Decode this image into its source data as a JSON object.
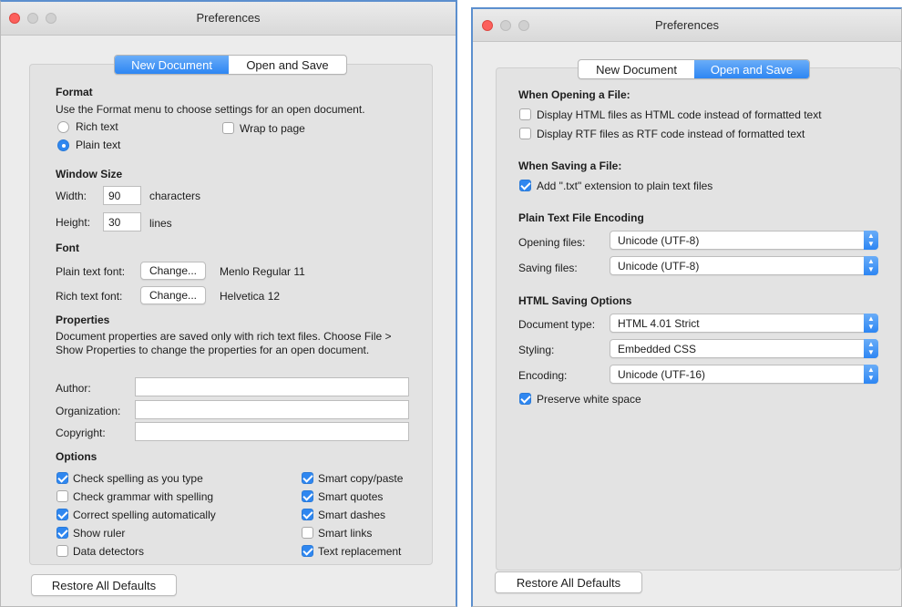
{
  "left": {
    "title": "Preferences",
    "tabs": {
      "new_document": "New Document",
      "open_and_save": "Open and Save",
      "active": "new_document"
    },
    "format": {
      "header": "Format",
      "description": "Use the Format menu to choose settings for an open document.",
      "rich_text": "Rich text",
      "plain_text": "Plain text",
      "selected": "plain_text",
      "wrap_to_page": "Wrap to page",
      "wrap_checked": false
    },
    "window_size": {
      "header": "Window Size",
      "width_label": "Width:",
      "width_value": "90",
      "width_unit": "characters",
      "height_label": "Height:",
      "height_value": "30",
      "height_unit": "lines"
    },
    "font": {
      "header": "Font",
      "plain_label": "Plain text font:",
      "plain_button": "Change...",
      "plain_value": "Menlo Regular 11",
      "rich_label": "Rich text font:",
      "rich_button": "Change...",
      "rich_value": "Helvetica 12"
    },
    "properties": {
      "header": "Properties",
      "description": "Document properties are saved only with rich text files. Choose File > Show Properties to change the properties for an open document.",
      "author_label": "Author:",
      "author_value": "",
      "organization_label": "Organization:",
      "organization_value": "",
      "copyright_label": "Copyright:",
      "copyright_value": ""
    },
    "options": {
      "header": "Options",
      "items": [
        {
          "label": "Check spelling as you type",
          "checked": true
        },
        {
          "label": "Check grammar with spelling",
          "checked": false
        },
        {
          "label": "Correct spelling automatically",
          "checked": true
        },
        {
          "label": "Show ruler",
          "checked": true
        },
        {
          "label": "Data detectors",
          "checked": false
        },
        {
          "label": "Smart copy/paste",
          "checked": true
        },
        {
          "label": "Smart quotes",
          "checked": true
        },
        {
          "label": "Smart dashes",
          "checked": true
        },
        {
          "label": "Smart links",
          "checked": false
        },
        {
          "label": "Text replacement",
          "checked": true
        }
      ]
    },
    "restore_button": "Restore All Defaults"
  },
  "right": {
    "title": "Preferences",
    "tabs": {
      "new_document": "New Document",
      "open_and_save": "Open and Save",
      "active": "open_and_save"
    },
    "opening": {
      "header": "When Opening a File:",
      "items": [
        {
          "label": "Display HTML files as HTML code instead of formatted text",
          "checked": false
        },
        {
          "label": "Display RTF files as RTF code instead of formatted text",
          "checked": false
        }
      ]
    },
    "saving": {
      "header": "When Saving a File:",
      "items": [
        {
          "label": "Add \".txt\" extension to plain text files",
          "checked": true
        }
      ]
    },
    "encoding": {
      "header": "Plain Text File Encoding",
      "opening_label": "Opening files:",
      "opening_value": "Unicode (UTF-8)",
      "saving_label": "Saving files:",
      "saving_value": "Unicode (UTF-8)"
    },
    "html": {
      "header": "HTML Saving Options",
      "doctype_label": "Document type:",
      "doctype_value": "HTML 4.01 Strict",
      "styling_label": "Styling:",
      "styling_value": "Embedded CSS",
      "encoding_label": "Encoding:",
      "encoding_value": "Unicode (UTF-16)",
      "preserve_label": "Preserve white space",
      "preserve_checked": true
    },
    "restore_button": "Restore All Defaults"
  },
  "colors": {
    "accent": "#2f87f0",
    "close": "#fc605c",
    "window_bg": "#ececec",
    "panel_bg": "#e3e3e3",
    "frame": "#5c8fce"
  },
  "icons": {
    "traffic_close": "close-dot",
    "traffic_minimize": "minimize-dot",
    "traffic_zoom": "zoom-dot",
    "popup_arrows": "updown-arrows"
  }
}
